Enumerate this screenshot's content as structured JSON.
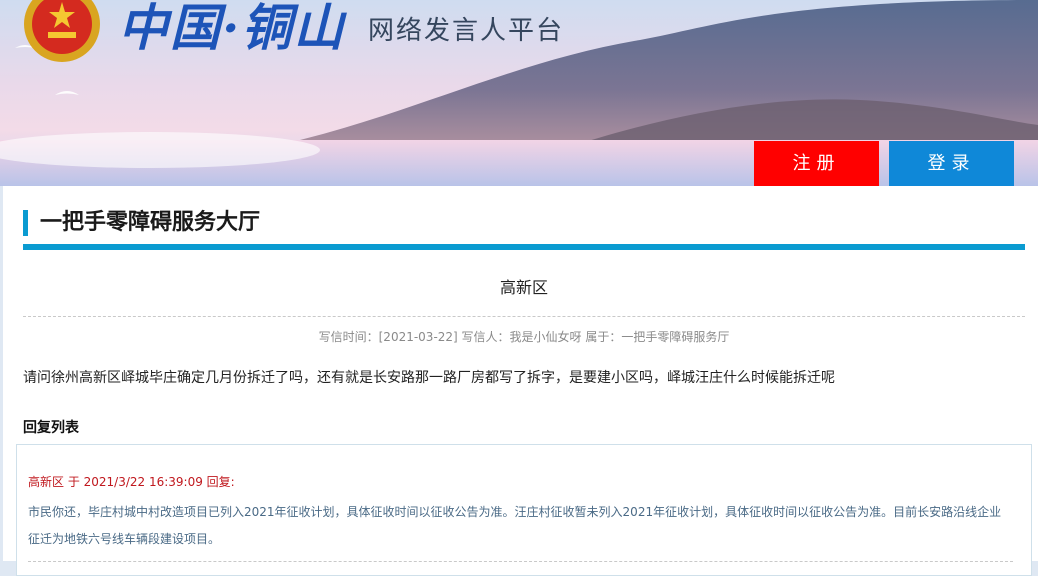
{
  "header": {
    "site_title": "中国·铜山",
    "site_subtitle": "网络发言人平台",
    "register_label": "注册",
    "login_label": "登录",
    "colors": {
      "register": "#ff0000",
      "login": "#0f88d8",
      "title": "#1d54b8"
    }
  },
  "page": {
    "section_title": "一把手零障碍服务大厅",
    "article_title": "高新区",
    "meta": "写信时间：[2021-03-22]  写信人：我是小仙女呀   属于：一把手零障碍服务厅",
    "question": "请问徐州高新区峄城毕庄确定几月份拆迁了吗，还有就是长安路那一路厂房都写了拆字，是要建小区吗，峄城汪庄什么时候能拆迁呢",
    "reply_list_label": "回复列表"
  },
  "replies": [
    {
      "header": "高新区 于 2021/3/22 16:39:09 回复:",
      "text": "市民你还，毕庄村城中村改造项目已列入2021年征收计划，具体征收时间以征收公告为准。汪庄村征收暂未列入2021年征收计划，具体征收时间以征收公告为准。目前长安路沿线企业征迁为地铁六号线车辆段建设项目。"
    }
  ]
}
